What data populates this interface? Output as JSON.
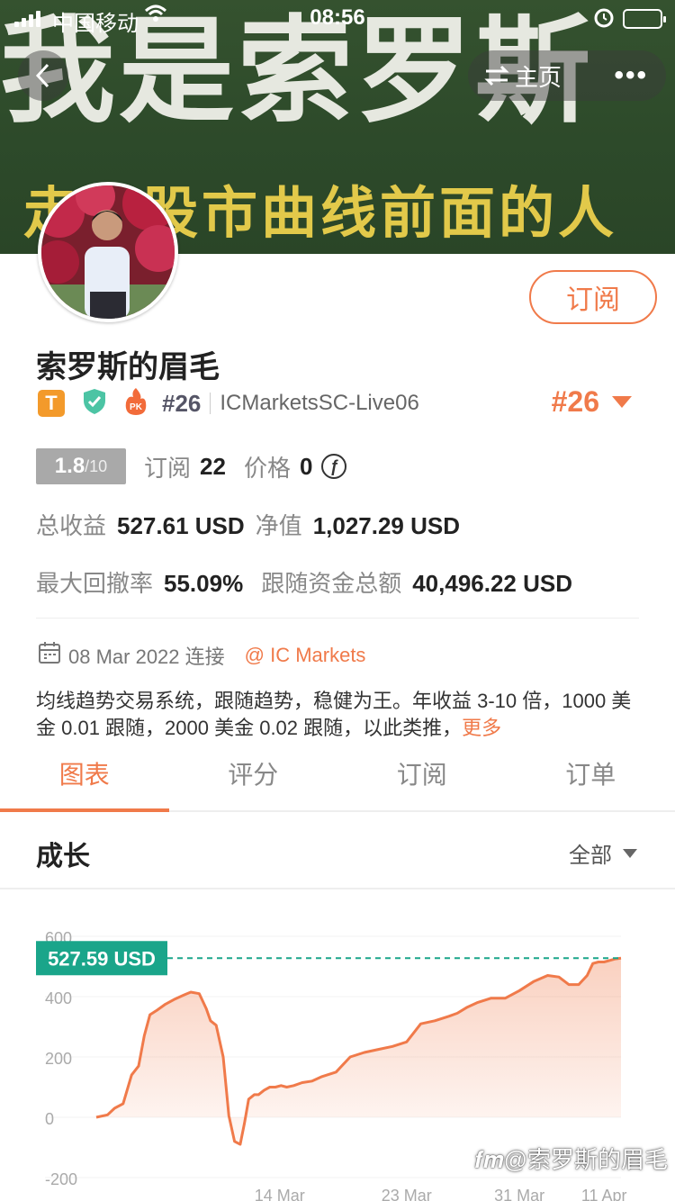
{
  "status_bar": {
    "carrier": "中国移动",
    "time": "08:56"
  },
  "banner": {
    "title": "我是索罗斯",
    "subtitle": "走在股市曲线前面的人"
  },
  "nav": {
    "home_label": "主页"
  },
  "profile": {
    "subscribe_label": "订阅",
    "name": "索罗斯的眉毛",
    "badge_t": "T",
    "badge_pk": "PK",
    "rank_small": "#26",
    "account": "ICMarketsSC-Live06",
    "rank_big": "#26",
    "score": "1.8",
    "score_max": "/10",
    "subscriptions_label": "订阅",
    "subscriptions_value": "22",
    "price_label": "价格",
    "price_value": "0",
    "price_icon": "ƒ",
    "total_profit_label": "总收益",
    "total_profit_value": "527.61 USD",
    "equity_label": "净值",
    "equity_value": "1,027.29 USD",
    "max_drawdown_label": "最大回撤率",
    "max_drawdown_value": "55.09%",
    "follow_funds_label": "跟随资金总额",
    "follow_funds_value": "40,496.22 USD",
    "connect_date": "08 Mar 2022 连接",
    "broker": "@ IC Markets",
    "description": "均线趋势交易系统，跟随趋势，稳健为王。年收益 3-10 倍，1000 美金 0.01 跟随，2000 美金 0.02 跟随，以此类推，",
    "more_label": "更多"
  },
  "tabs": [
    {
      "label": "图表",
      "active": true
    },
    {
      "label": "评分",
      "active": false
    },
    {
      "label": "订阅",
      "active": false
    },
    {
      "label": "订单",
      "active": false
    }
  ],
  "growth": {
    "title": "成长",
    "filter_label": "全部"
  },
  "chart_data": {
    "type": "area",
    "ylim": [
      -200,
      600
    ],
    "y_ticks": [
      600,
      400,
      200,
      0,
      -200
    ],
    "x_ticks": [
      {
        "label": "14 Mar",
        "x": 13
      },
      {
        "label": "23 Mar",
        "x": 22
      },
      {
        "label": "31 Mar",
        "x": 30
      },
      {
        "label": "11 Apr",
        "x": 36
      }
    ],
    "current_label": "527.59 USD",
    "current_value": 527.59,
    "series": [
      {
        "x": [
          0,
          0.8,
          1.3,
          1.9,
          2.5,
          3.0,
          3.4,
          3.8,
          4.3,
          4.9,
          5.5,
          6.2,
          6.7,
          7.3,
          7.8,
          8.1,
          8.5,
          9.0,
          9.4,
          9.8,
          10.2,
          10.5,
          10.8,
          11.2,
          11.5,
          11.9,
          12.3,
          12.7,
          13.1,
          13.5,
          14.0,
          14.6,
          15.3,
          16.0,
          17.0,
          18.0,
          19.0,
          20.0,
          21.0,
          22.0,
          23.0,
          24.0,
          25.0,
          25.6,
          26.3,
          27.0,
          28.0,
          29.0,
          30.0,
          31.0,
          32.0,
          32.8,
          33.5,
          34.2,
          34.8,
          35.2,
          35.6,
          36.0,
          36.4,
          36.8,
          37.2
        ],
        "values": [
          0,
          8,
          30,
          45,
          140,
          170,
          270,
          340,
          355,
          375,
          390,
          405,
          415,
          410,
          360,
          320,
          305,
          200,
          5,
          -80,
          -90,
          -20,
          60,
          75,
          75,
          90,
          100,
          100,
          105,
          100,
          105,
          115,
          120,
          135,
          150,
          200,
          215,
          225,
          235,
          250,
          310,
          320,
          335,
          345,
          365,
          380,
          395,
          395,
          420,
          450,
          470,
          465,
          440,
          440,
          470,
          510,
          515,
          515,
          520,
          525,
          527.59
        ]
      }
    ],
    "colors": {
      "line": "#f07a4a",
      "accent": "#1aa58a"
    }
  }
}
